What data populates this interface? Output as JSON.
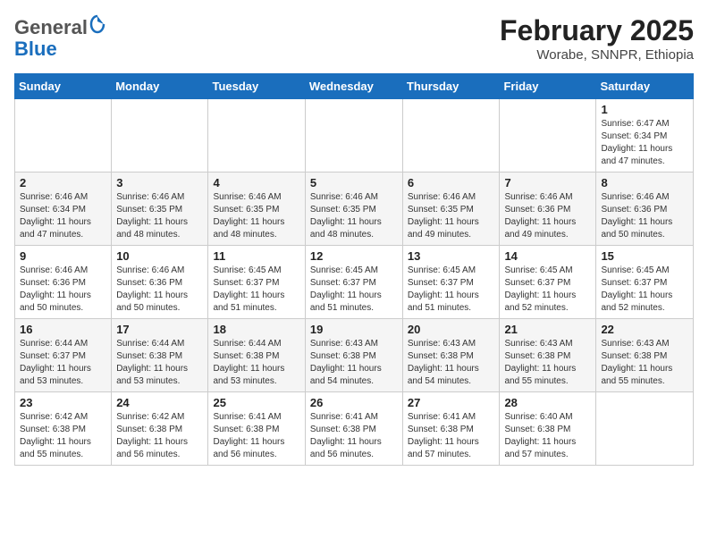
{
  "header": {
    "logo_general": "General",
    "logo_blue": "Blue",
    "month_year": "February 2025",
    "location": "Worabe, SNNPR, Ethiopia"
  },
  "weekdays": [
    "Sunday",
    "Monday",
    "Tuesday",
    "Wednesday",
    "Thursday",
    "Friday",
    "Saturday"
  ],
  "weeks": [
    [
      {
        "day": "",
        "info": ""
      },
      {
        "day": "",
        "info": ""
      },
      {
        "day": "",
        "info": ""
      },
      {
        "day": "",
        "info": ""
      },
      {
        "day": "",
        "info": ""
      },
      {
        "day": "",
        "info": ""
      },
      {
        "day": "1",
        "info": "Sunrise: 6:47 AM\nSunset: 6:34 PM\nDaylight: 11 hours and 47 minutes."
      }
    ],
    [
      {
        "day": "2",
        "info": "Sunrise: 6:46 AM\nSunset: 6:34 PM\nDaylight: 11 hours and 47 minutes."
      },
      {
        "day": "3",
        "info": "Sunrise: 6:46 AM\nSunset: 6:35 PM\nDaylight: 11 hours and 48 minutes."
      },
      {
        "day": "4",
        "info": "Sunrise: 6:46 AM\nSunset: 6:35 PM\nDaylight: 11 hours and 48 minutes."
      },
      {
        "day": "5",
        "info": "Sunrise: 6:46 AM\nSunset: 6:35 PM\nDaylight: 11 hours and 48 minutes."
      },
      {
        "day": "6",
        "info": "Sunrise: 6:46 AM\nSunset: 6:35 PM\nDaylight: 11 hours and 49 minutes."
      },
      {
        "day": "7",
        "info": "Sunrise: 6:46 AM\nSunset: 6:36 PM\nDaylight: 11 hours and 49 minutes."
      },
      {
        "day": "8",
        "info": "Sunrise: 6:46 AM\nSunset: 6:36 PM\nDaylight: 11 hours and 50 minutes."
      }
    ],
    [
      {
        "day": "9",
        "info": "Sunrise: 6:46 AM\nSunset: 6:36 PM\nDaylight: 11 hours and 50 minutes."
      },
      {
        "day": "10",
        "info": "Sunrise: 6:46 AM\nSunset: 6:36 PM\nDaylight: 11 hours and 50 minutes."
      },
      {
        "day": "11",
        "info": "Sunrise: 6:45 AM\nSunset: 6:37 PM\nDaylight: 11 hours and 51 minutes."
      },
      {
        "day": "12",
        "info": "Sunrise: 6:45 AM\nSunset: 6:37 PM\nDaylight: 11 hours and 51 minutes."
      },
      {
        "day": "13",
        "info": "Sunrise: 6:45 AM\nSunset: 6:37 PM\nDaylight: 11 hours and 51 minutes."
      },
      {
        "day": "14",
        "info": "Sunrise: 6:45 AM\nSunset: 6:37 PM\nDaylight: 11 hours and 52 minutes."
      },
      {
        "day": "15",
        "info": "Sunrise: 6:45 AM\nSunset: 6:37 PM\nDaylight: 11 hours and 52 minutes."
      }
    ],
    [
      {
        "day": "16",
        "info": "Sunrise: 6:44 AM\nSunset: 6:37 PM\nDaylight: 11 hours and 53 minutes."
      },
      {
        "day": "17",
        "info": "Sunrise: 6:44 AM\nSunset: 6:38 PM\nDaylight: 11 hours and 53 minutes."
      },
      {
        "day": "18",
        "info": "Sunrise: 6:44 AM\nSunset: 6:38 PM\nDaylight: 11 hours and 53 minutes."
      },
      {
        "day": "19",
        "info": "Sunrise: 6:43 AM\nSunset: 6:38 PM\nDaylight: 11 hours and 54 minutes."
      },
      {
        "day": "20",
        "info": "Sunrise: 6:43 AM\nSunset: 6:38 PM\nDaylight: 11 hours and 54 minutes."
      },
      {
        "day": "21",
        "info": "Sunrise: 6:43 AM\nSunset: 6:38 PM\nDaylight: 11 hours and 55 minutes."
      },
      {
        "day": "22",
        "info": "Sunrise: 6:43 AM\nSunset: 6:38 PM\nDaylight: 11 hours and 55 minutes."
      }
    ],
    [
      {
        "day": "23",
        "info": "Sunrise: 6:42 AM\nSunset: 6:38 PM\nDaylight: 11 hours and 55 minutes."
      },
      {
        "day": "24",
        "info": "Sunrise: 6:42 AM\nSunset: 6:38 PM\nDaylight: 11 hours and 56 minutes."
      },
      {
        "day": "25",
        "info": "Sunrise: 6:41 AM\nSunset: 6:38 PM\nDaylight: 11 hours and 56 minutes."
      },
      {
        "day": "26",
        "info": "Sunrise: 6:41 AM\nSunset: 6:38 PM\nDaylight: 11 hours and 56 minutes."
      },
      {
        "day": "27",
        "info": "Sunrise: 6:41 AM\nSunset: 6:38 PM\nDaylight: 11 hours and 57 minutes."
      },
      {
        "day": "28",
        "info": "Sunrise: 6:40 AM\nSunset: 6:38 PM\nDaylight: 11 hours and 57 minutes."
      },
      {
        "day": "",
        "info": ""
      }
    ]
  ]
}
